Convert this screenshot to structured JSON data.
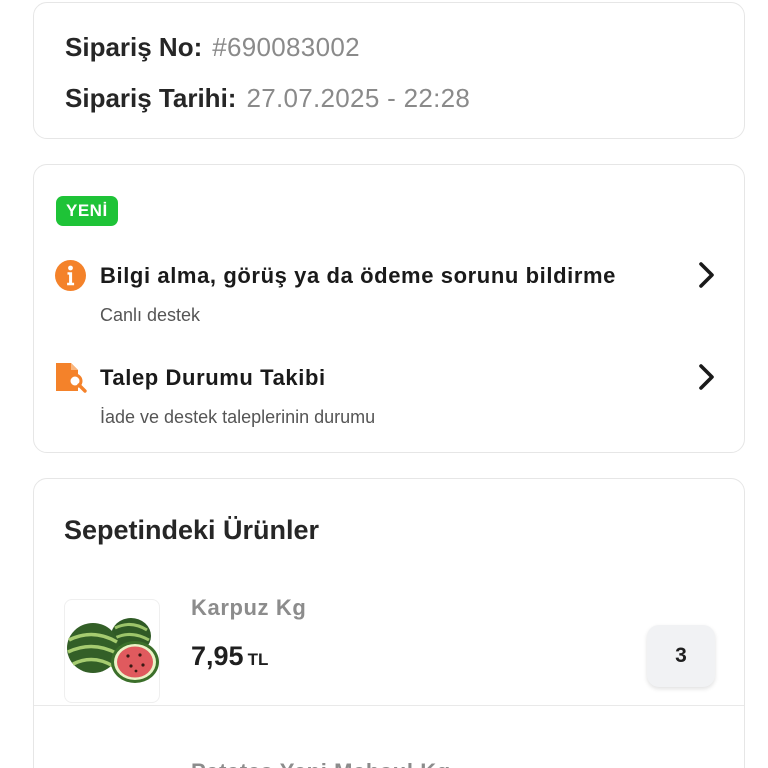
{
  "order": {
    "no_label": "Sipariş No:",
    "no_value": "#690083002",
    "date_label": "Sipariş Tarihi:",
    "date_value": "27.07.2025 - 22:28"
  },
  "support": {
    "badge": "YENİ",
    "items": [
      {
        "icon": "info-circle-icon",
        "title": "Bilgi alma, görüş ya da ödeme sorunu bildirme",
        "subtitle": "Canlı destek"
      },
      {
        "icon": "document-search-icon",
        "title": "Talep Durumu Takibi",
        "subtitle": "İade ve destek taleplerinin durumu"
      }
    ]
  },
  "basket": {
    "title": "Sepetindeki Ürünler",
    "products": [
      {
        "name": "Karpuz Kg",
        "price": "7,95",
        "currency": "TL",
        "quantity": "3",
        "image": "watermelon-image"
      },
      {
        "name": "Patates Yeni Mahsul Kg"
      }
    ]
  },
  "colors": {
    "accent_orange": "#f4822a",
    "badge_green": "#1ec337",
    "card_border": "#e6e6e6"
  }
}
